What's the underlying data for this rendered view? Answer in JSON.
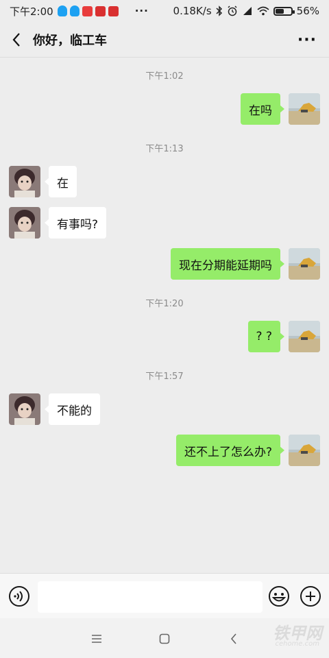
{
  "status_bar": {
    "time": "下午2:00",
    "dots": "···",
    "network_speed": "0.18K/s",
    "battery_percent": "56%",
    "battery_level": 0.56,
    "app_icons": [
      "qq-icon",
      "qq-icon",
      "app-icon",
      "app-icon",
      "app-icon"
    ]
  },
  "header": {
    "title": "你好，临工车",
    "back_icon": "chevron-left-icon",
    "more_icon": "more-icon",
    "more_label": "···"
  },
  "messages": [
    {
      "type": "time",
      "text": "下午1:02"
    },
    {
      "type": "out",
      "text": "在吗"
    },
    {
      "type": "time",
      "text": "下午1:13"
    },
    {
      "type": "in",
      "text": "在"
    },
    {
      "type": "in",
      "text": "有事吗?"
    },
    {
      "type": "out",
      "text": "现在分期能延期吗"
    },
    {
      "type": "time",
      "text": "下午1:20"
    },
    {
      "type": "out",
      "text": "? ?"
    },
    {
      "type": "time",
      "text": "下午1:57"
    },
    {
      "type": "in",
      "text": "不能的"
    },
    {
      "type": "out",
      "text": "还不上了怎么办?"
    }
  ],
  "input_bar": {
    "voice_icon": "voice-icon",
    "value": "",
    "emoji_icon": "emoji-icon",
    "plus_icon": "plus-icon"
  },
  "nav_bar": {
    "menu_icon": "menu-icon",
    "home_icon": "home-icon",
    "back_icon": "back-icon"
  },
  "watermark": {
    "text": "铁甲网",
    "sub": "cehome.com"
  },
  "colors": {
    "background": "#ededed",
    "outgoing_bubble": "#95ec69",
    "incoming_bubble": "#ffffff",
    "timestamp": "#8a8a8a"
  }
}
